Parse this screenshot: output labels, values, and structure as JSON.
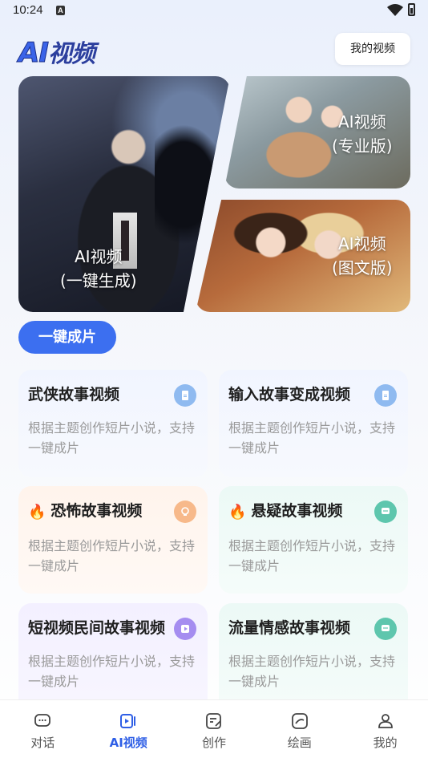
{
  "status": {
    "time": "10:24",
    "notif": "A"
  },
  "header": {
    "logo_ai": "AI",
    "logo_cn": "视频",
    "my_videos": "我的视频"
  },
  "banners": {
    "main": {
      "line1": "AI视频",
      "line2": "(一键生成)"
    },
    "pro": {
      "line1": "AI视频",
      "line2": "(专业版)"
    },
    "tuwen": {
      "line1": "AI视频",
      "line2": "(图文版)"
    }
  },
  "primary_button": "一键成片",
  "cards": [
    {
      "title": "武侠故事视频",
      "desc": "根据主题创作短片小说，支持一键成片",
      "hot": false,
      "icon": "document-icon",
      "color": "#8fbaf0"
    },
    {
      "title": "输入故事变成视频",
      "desc": "根据主题创作短片小说，支持一键成片",
      "hot": false,
      "icon": "document-icon",
      "color": "#8fbaf0"
    },
    {
      "title": "恐怖故事视频",
      "desc": "根据主题创作短片小说，支持一键成片",
      "hot": true,
      "icon": "bulb-icon",
      "color": "#f7b98a"
    },
    {
      "title": "悬疑故事视频",
      "desc": "根据主题创作短片小说，支持一键成片",
      "hot": true,
      "icon": "chat-icon",
      "color": "#5ec6ad"
    },
    {
      "title": "短视频民间故事视频",
      "desc": "根据主题创作短片小说，支持一键成片",
      "hot": false,
      "icon": "play-icon",
      "color": "#a58df0"
    },
    {
      "title": "流量情感故事视频",
      "desc": "根据主题创作短片小说，支持一键成片",
      "hot": false,
      "icon": "chat-icon",
      "color": "#5ec6ad"
    }
  ],
  "tabs": [
    {
      "label": "对话",
      "icon": "chat-bubble-icon",
      "active": false
    },
    {
      "label": "AI视频",
      "icon": "video-icon",
      "active": true
    },
    {
      "label": "创作",
      "icon": "edit-icon",
      "active": false
    },
    {
      "label": "绘画",
      "icon": "draw-icon",
      "active": false
    },
    {
      "label": "我的",
      "icon": "user-icon",
      "active": false
    }
  ]
}
